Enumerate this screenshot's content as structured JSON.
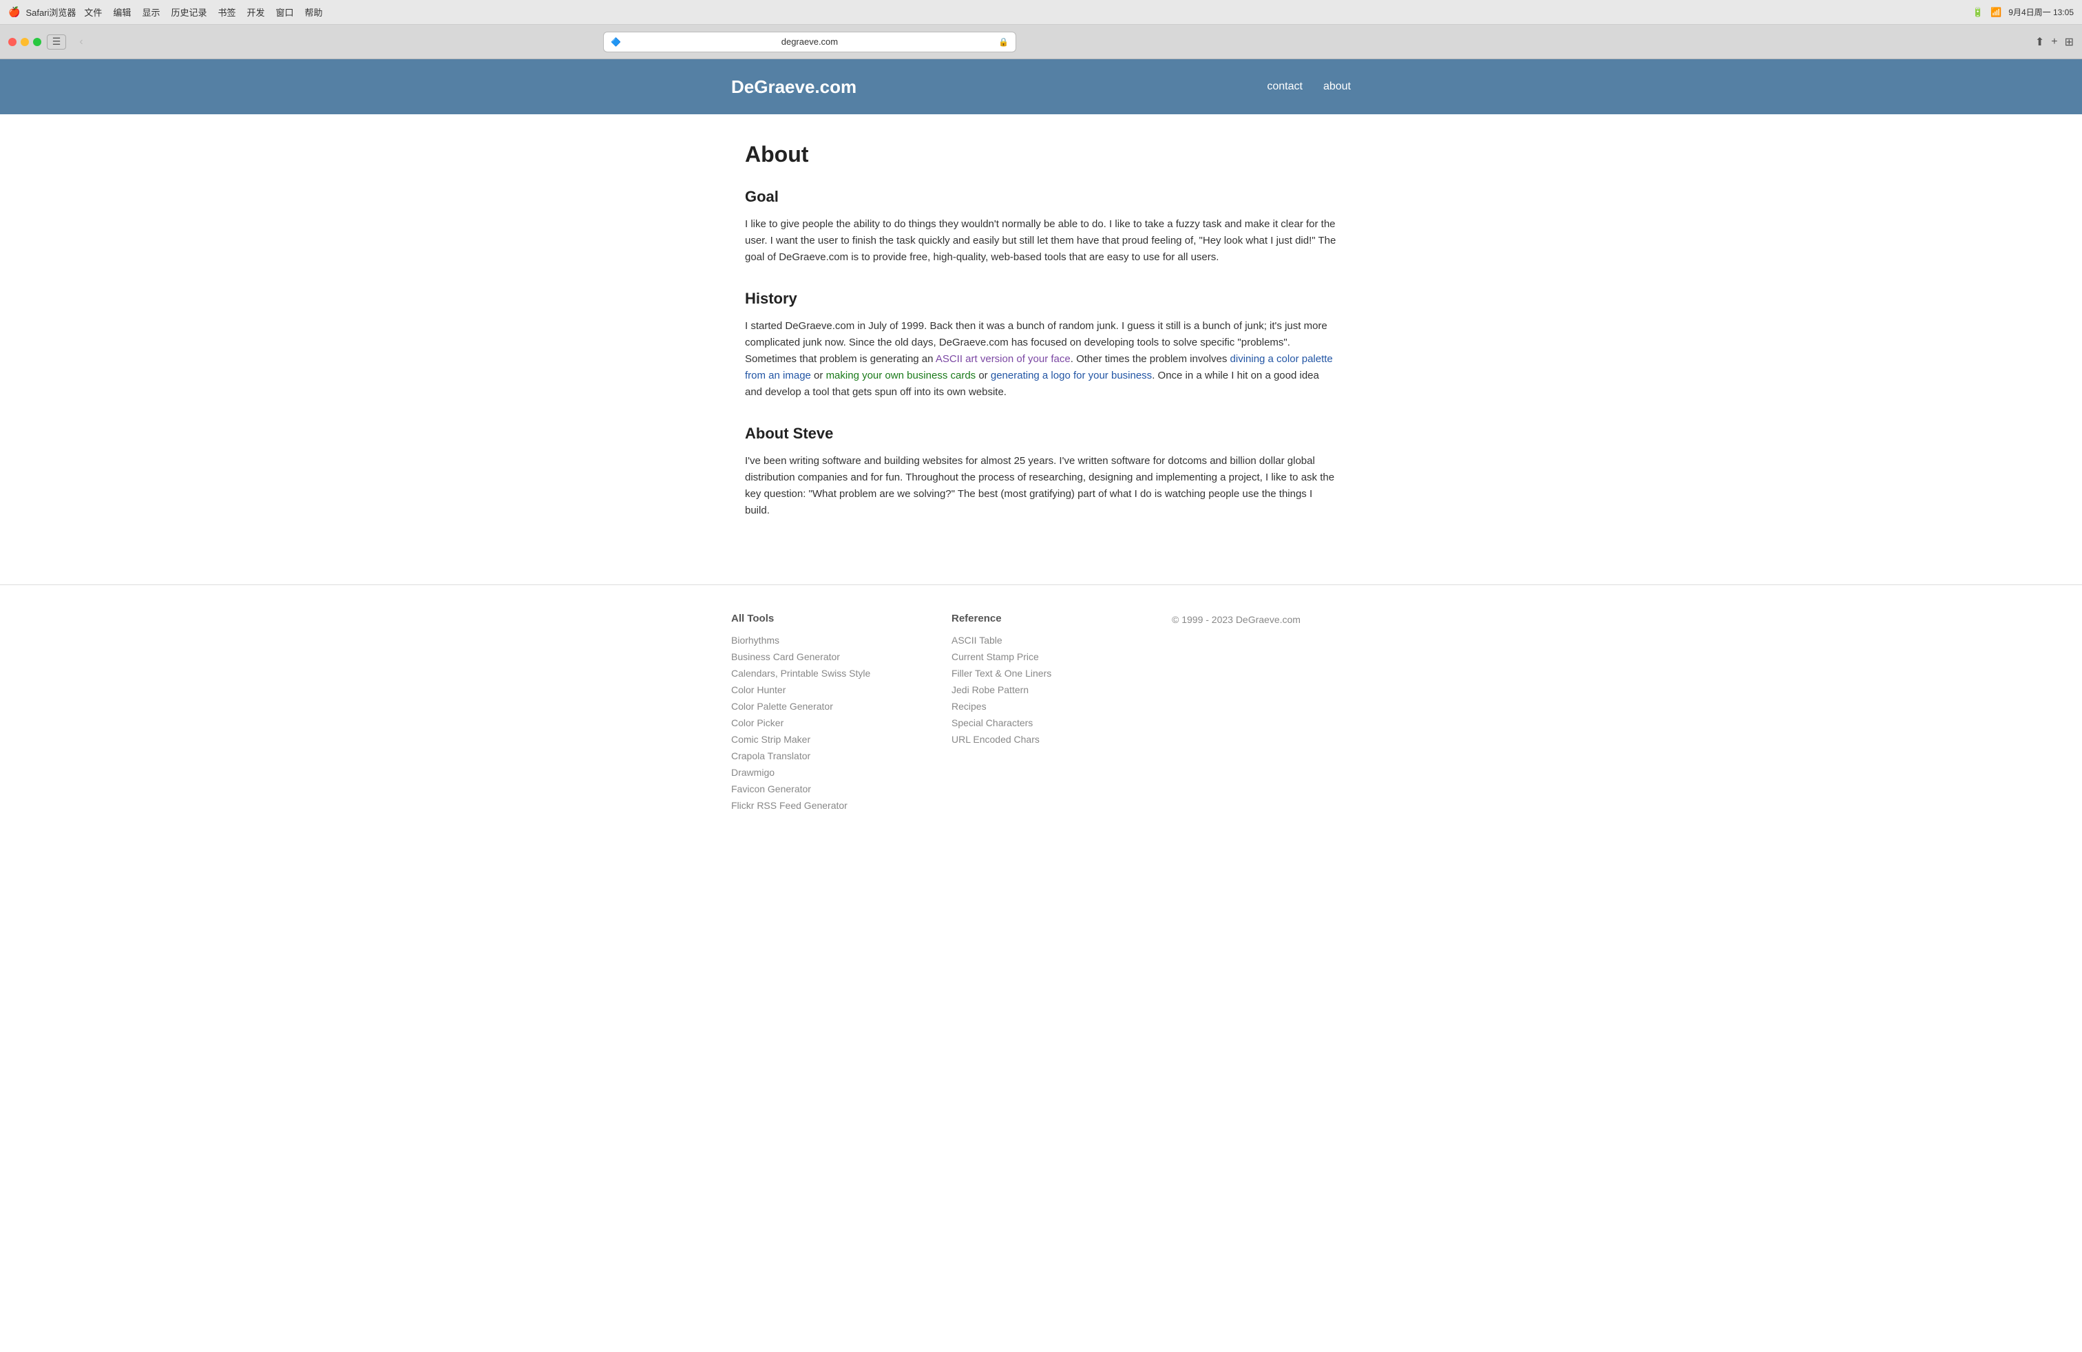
{
  "macbar": {
    "apple_icon": "🍎",
    "browser_name": "Safari浏览器",
    "menus": [
      "文件",
      "编辑",
      "显示",
      "历史记录",
      "书签",
      "开发",
      "窗口",
      "帮助"
    ],
    "datetime": "9月4日周一 13:05"
  },
  "browser": {
    "address": "degraeve.com",
    "lock_icon": "🔒",
    "back_label": "‹",
    "forward_label": "›"
  },
  "header": {
    "logo": "DeGraeve.com",
    "nav": {
      "contact": "contact",
      "about": "about"
    }
  },
  "page": {
    "title": "About",
    "sections": [
      {
        "id": "goal",
        "heading": "Goal",
        "body": "I like to give people the ability to do things they wouldn't normally be able to do. I like to take a fuzzy task and make it clear for the user. I want the user to finish the task quickly and easily but still let them have that proud feeling of, \"Hey look what I just did!\" The goal of DeGraeve.com is to provide free, high-quality, web-based tools that are easy to use for all users."
      },
      {
        "id": "history",
        "heading": "History",
        "body_parts": [
          "I started DeGraeve.com in July of 1999. Back then it was a bunch of random junk. I guess it still is a bunch of junk; it's just more complicated junk now. Since the old days, DeGraeve.com has focused on developing tools to solve specific \"problems\". Sometimes that problem is generating an ",
          "ASCII art version of your face",
          ". Other times the problem involves ",
          "divining a color palette from an image",
          " or ",
          "making your own business cards",
          " or ",
          "generating a logo for your business",
          ". Once in a while I hit on a good idea and develop a tool that gets spun off into its own website."
        ],
        "links": {
          "ascii": "ASCII art version of your face",
          "color": "divining a color palette from an image",
          "cards": "making your own business cards",
          "logo": "generating a logo for your business"
        }
      },
      {
        "id": "about-steve",
        "heading": "About Steve",
        "body": "I've been writing software and building websites for almost 25 years. I've written software for dotcoms and billion dollar global distribution companies and for fun. Throughout the process of researching, designing and implementing a project, I like to ask the key question: \"What problem are we solving?\" The best (most gratifying) part of what I do is watching people use the things I build."
      }
    ]
  },
  "footer": {
    "columns": [
      {
        "title": "All Tools",
        "items": [
          "Biorhythms",
          "Business Card Generator",
          "Calendars, Printable Swiss Style",
          "Color Hunter",
          "Color Palette Generator",
          "Color Picker",
          "Comic Strip Maker",
          "Crapola Translator",
          "Drawmigo",
          "Favicon Generator",
          "Flickr RSS Feed Generator"
        ]
      },
      {
        "title": "Reference",
        "items": [
          "ASCII Table",
          "Current Stamp Price",
          "Filler Text & One Liners",
          "Jedi Robe Pattern",
          "Recipes",
          "Special Characters",
          "URL Encoded Chars"
        ]
      }
    ],
    "copyright": "© 1999 - 2023 DeGraeve.com"
  }
}
